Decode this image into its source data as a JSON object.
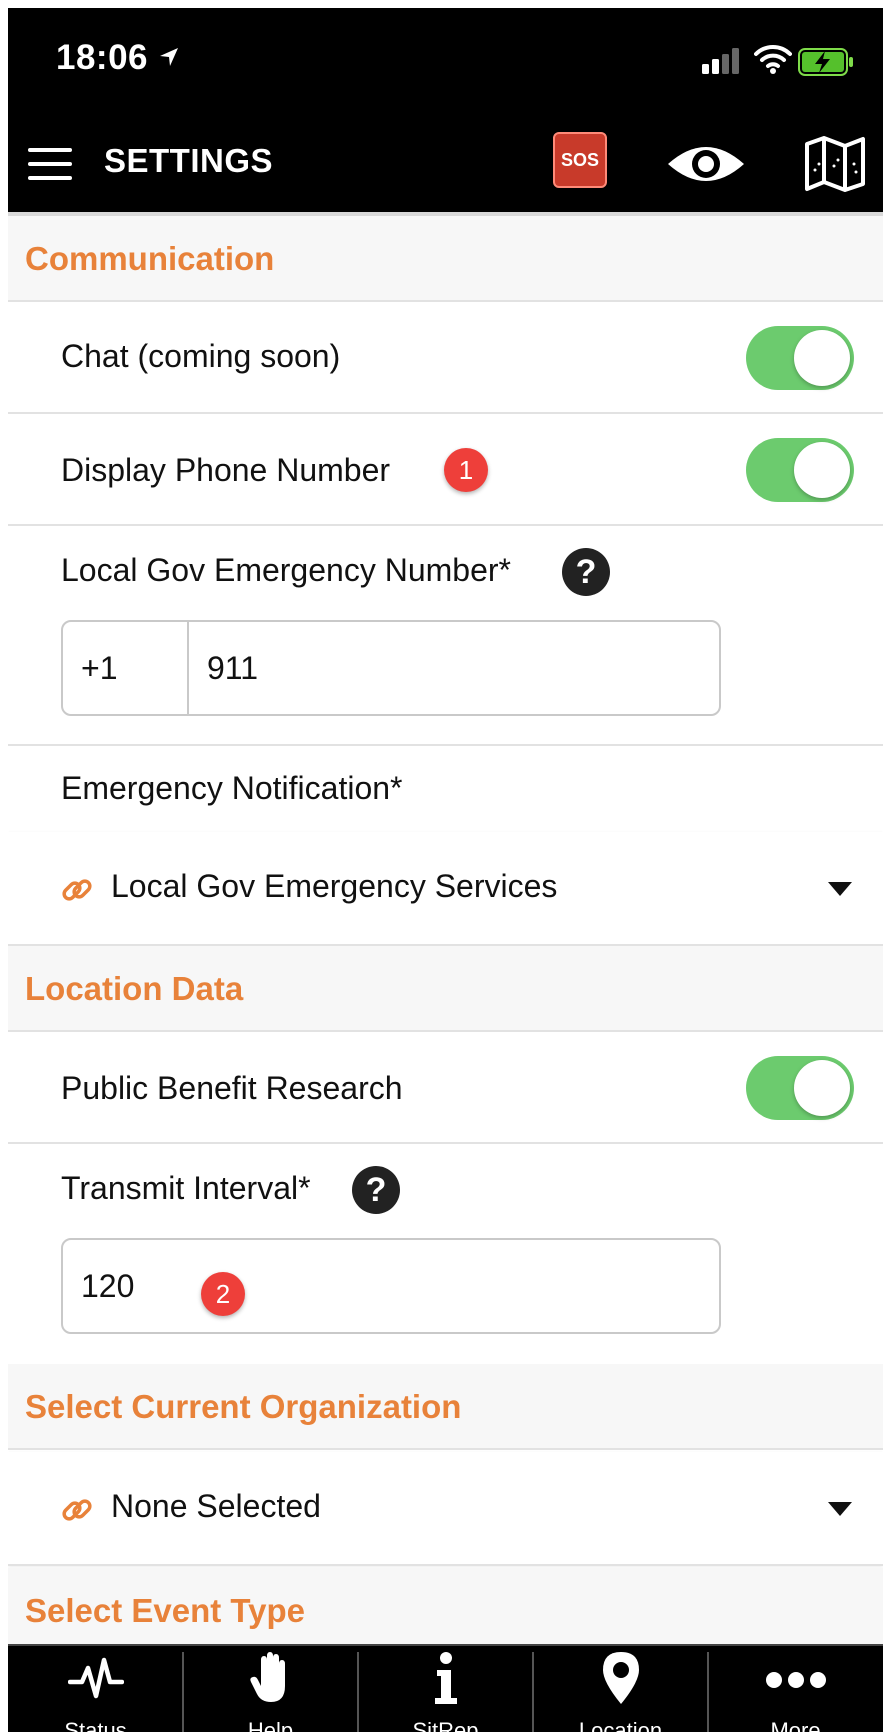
{
  "status_bar": {
    "time": "18:06"
  },
  "nav": {
    "title": "SETTINGS",
    "sos_label": "SOS"
  },
  "sections": {
    "communication": {
      "header": "Communication",
      "chat_label": "Chat (coming soon)",
      "display_phone_label": "Display Phone Number",
      "display_phone_badge": "1",
      "emergency_number_label": "Local Gov Emergency Number*",
      "help_glyph": "?",
      "country_code": "+1",
      "emergency_number_value": "911",
      "emergency_notification_label": "Emergency Notification*",
      "emergency_notification_value": "Local Gov Emergency Services"
    },
    "location": {
      "header": "Location Data",
      "public_benefit_label": "Public Benefit Research",
      "transmit_interval_label": "Transmit Interval*",
      "transmit_interval_value": "120",
      "transmit_badge": "2"
    },
    "organization": {
      "header": "Select Current Organization",
      "value": "None Selected"
    },
    "event_type": {
      "header": "Select Event Type"
    }
  },
  "toggles": {
    "chat": true,
    "display_phone": true,
    "public_benefit": true
  },
  "tabs": [
    {
      "label": "Status",
      "icon": "pulse-icon"
    },
    {
      "label": "Help",
      "icon": "hand-icon"
    },
    {
      "label": "SitRep",
      "icon": "info-icon"
    },
    {
      "label": "Location",
      "icon": "map-pin-icon"
    },
    {
      "label": "More",
      "icon": "more-icon"
    }
  ],
  "colors": {
    "accent": "#e8823a",
    "toggle_on": "#6ccb6e",
    "badge": "#ee3f3a",
    "sos": "#c83a2a"
  }
}
